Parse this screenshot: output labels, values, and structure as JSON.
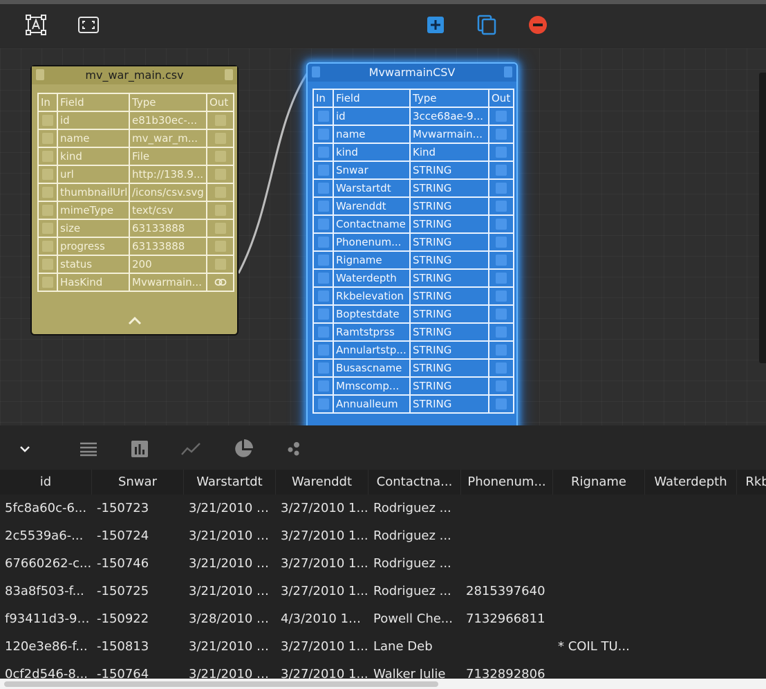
{
  "toolbar": {
    "left_icons": [
      "text-frame-icon",
      "fit-screen-icon"
    ],
    "center_icons": [
      "add-node-icon",
      "copy-icon",
      "remove-icon"
    ],
    "colors": {
      "add": "#2f8fe0",
      "copy": "#2f8fe0",
      "remove": "#e8452f"
    }
  },
  "csv_node": {
    "title": "mv_war_main.csv",
    "headers": {
      "in": "In",
      "field": "Field",
      "type": "Type",
      "out": "Out"
    },
    "rows": [
      {
        "field": "id",
        "type": "e81b30ec-..."
      },
      {
        "field": "name",
        "type": "mv_war_m..."
      },
      {
        "field": "kind",
        "type": "File"
      },
      {
        "field": "url",
        "type": "http://138.9..."
      },
      {
        "field": "thumbnailUrl",
        "type": "/icons/csv.svg"
      },
      {
        "field": "mimeType",
        "type": "text/csv"
      },
      {
        "field": "size",
        "type": "63133888"
      },
      {
        "field": "progress",
        "type": "63133888"
      },
      {
        "field": "status",
        "type": "200"
      },
      {
        "field": "HasKind",
        "type": "Mvwarmain..."
      }
    ],
    "color": "#b0a866"
  },
  "mv_node": {
    "title": "MvwarmainCSV",
    "headers": {
      "in": "In",
      "field": "Field",
      "type": "Type",
      "out": "Out"
    },
    "rows": [
      {
        "field": "id",
        "type": "3cce68ae-9..."
      },
      {
        "field": "name",
        "type": "Mvwarmain..."
      },
      {
        "field": "kind",
        "type": "Kind"
      },
      {
        "field": "Snwar",
        "type": "STRING"
      },
      {
        "field": "Warstartdt",
        "type": "STRING"
      },
      {
        "field": "Warenddt",
        "type": "STRING"
      },
      {
        "field": "Contactname",
        "type": "STRING"
      },
      {
        "field": "Phonenum...",
        "type": "STRING"
      },
      {
        "field": "Rigname",
        "type": "STRING"
      },
      {
        "field": "Waterdepth",
        "type": "STRING"
      },
      {
        "field": "Rkbelevation",
        "type": "STRING"
      },
      {
        "field": "Boptestdate",
        "type": "STRING"
      },
      {
        "field": "Ramtstprss",
        "type": "STRING"
      },
      {
        "field": "Annulartstp...",
        "type": "STRING"
      },
      {
        "field": "Busascname",
        "type": "STRING"
      },
      {
        "field": "Mmscomp...",
        "type": "STRING"
      },
      {
        "field": "Annualleum",
        "type": "STRING"
      }
    ],
    "color": "#2f7fd8"
  },
  "bottom_toolbar": {
    "icons": [
      "chevron-down-icon",
      "list-view-icon",
      "bar-chart-icon",
      "line-chart-icon",
      "pie-chart-icon",
      "scatter-chart-icon"
    ]
  },
  "grid": {
    "columns": [
      "id",
      "Snwar",
      "Warstartdt",
      "Warenddt",
      "Contactna...",
      "Phonenum...",
      "Rigname",
      "Waterdepth",
      "Rkb"
    ],
    "rows": [
      [
        "5fc8a60c-6...",
        "-150723",
        "3/21/2010 1...",
        "3/27/2010 1...",
        "Rodriguez ...",
        "",
        "",
        "",
        ""
      ],
      [
        "2c5539a6-...",
        "-150724",
        "3/21/2010 1...",
        "3/27/2010 1...",
        "Rodriguez ...",
        "",
        "",
        "",
        ""
      ],
      [
        "67660262-c...",
        "-150746",
        "3/21/2010 1...",
        "3/27/2010 1...",
        "Rodriguez ...",
        "",
        "",
        "",
        ""
      ],
      [
        "83a8f503-f...",
        "-150725",
        "3/21/2010 1...",
        "3/27/2010 1...",
        "Rodriguez ...",
        "2815397640",
        "",
        "",
        ""
      ],
      [
        "f93411d3-9f...",
        "-150922",
        "3/28/2010 1...",
        "4/3/2010 11:...",
        "Powell Che...",
        "7132966811",
        "",
        "",
        ""
      ],
      [
        "120e3e86-f...",
        "-150813",
        "3/21/2010 1...",
        "3/27/2010 1...",
        "Lane Deb",
        "",
        "* COIL TU...",
        "",
        ""
      ],
      [
        "0cf2d546-8...",
        "-150764",
        "3/21/2010 1...",
        "3/27/2010 1...",
        "Walker Julie",
        "7132892806",
        "",
        "",
        ""
      ]
    ]
  }
}
